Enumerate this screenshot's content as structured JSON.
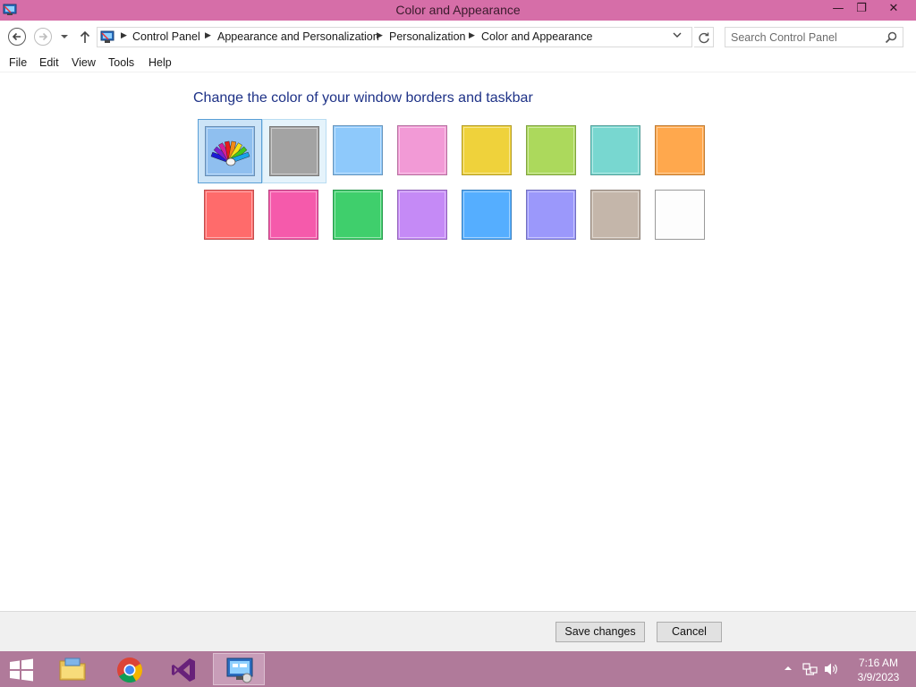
{
  "window": {
    "title": "Color and Appearance",
    "controls": {
      "minimize": "—",
      "maximize": "❐",
      "close": "✕"
    }
  },
  "address": {
    "breadcrumbs": [
      "Control Panel",
      "Appearance and Personalization",
      "Personalization",
      "Color and Appearance"
    ],
    "search_placeholder": "Search Control Panel"
  },
  "menu": [
    "File",
    "Edit",
    "View",
    "Tools",
    "Help"
  ],
  "content": {
    "heading": "Change the color of your window borders and taskbar",
    "selected_index": 0,
    "hovered_index": 1,
    "swatches": [
      {
        "name": "automatic",
        "color": "#8fbfef",
        "icon": "color-palette-icon"
      },
      {
        "name": "gray",
        "color": "#a3a3a3"
      },
      {
        "name": "light-blue",
        "color": "#8ec9fb"
      },
      {
        "name": "pink",
        "color": "#f29ad6"
      },
      {
        "name": "yellow",
        "color": "#efd23b"
      },
      {
        "name": "lime",
        "color": "#acd95c"
      },
      {
        "name": "teal",
        "color": "#78d7d0"
      },
      {
        "name": "orange",
        "color": "#ffa84d"
      },
      {
        "name": "red",
        "color": "#ff6b6b"
      },
      {
        "name": "magenta",
        "color": "#f55aab"
      },
      {
        "name": "green",
        "color": "#3fcf6c"
      },
      {
        "name": "violet",
        "color": "#c58af6"
      },
      {
        "name": "blue",
        "color": "#55aeff"
      },
      {
        "name": "periwinkle",
        "color": "#9b98fb"
      },
      {
        "name": "taupe",
        "color": "#c4b6aa"
      },
      {
        "name": "white",
        "color": "#fdfdfd"
      }
    ]
  },
  "buttons": {
    "save": "Save changes",
    "cancel": "Cancel"
  },
  "taskbar": {
    "apps": [
      {
        "name": "file-explorer",
        "icon": "folder-icon"
      },
      {
        "name": "chrome",
        "icon": "chrome-icon"
      },
      {
        "name": "visual-studio",
        "icon": "visual-studio-icon"
      },
      {
        "name": "control-panel",
        "icon": "control-panel-icon",
        "active": true
      }
    ],
    "time": "7:16 AM",
    "date": "3/9/2023"
  }
}
